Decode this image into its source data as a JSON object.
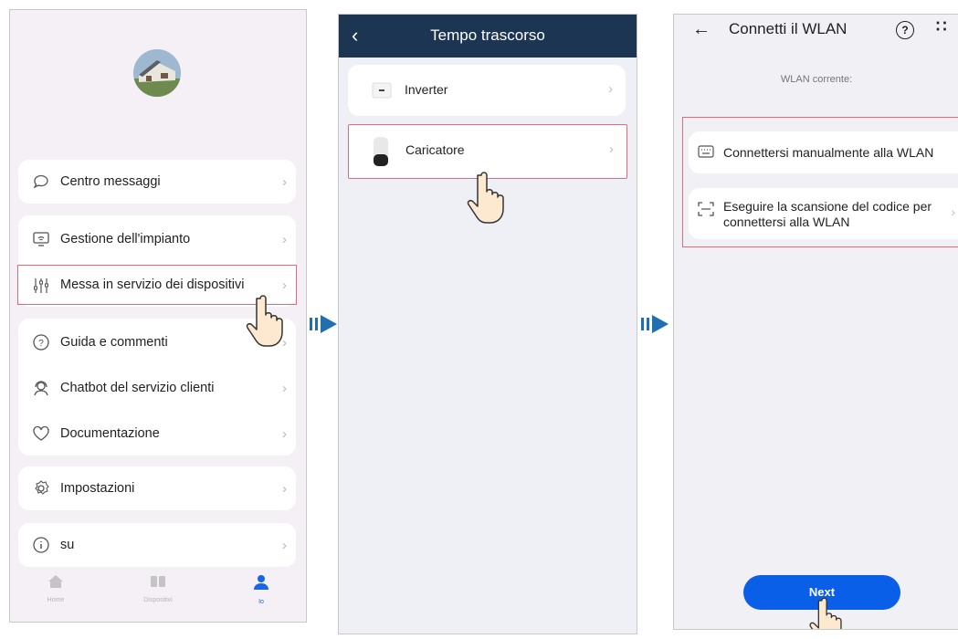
{
  "screen1": {
    "menu": {
      "messages": "Centro messaggi",
      "plant": "Gestione dell'impianto",
      "commissioning": "Messa in servizio dei dispositivi",
      "guide": "Guida e commenti",
      "chatbot": "Chatbot del servizio clienti",
      "docs": "Documentazione",
      "settings": "Impostazioni",
      "about": "su"
    },
    "tabs": {
      "home": "Home",
      "devices": "Dispositivi",
      "me": "Io"
    },
    "colors": {
      "active_tab": "#1767e6",
      "highlight": "#e36a78"
    }
  },
  "screen2": {
    "title": "Tempo trascorso",
    "items": {
      "inverter": "Inverter",
      "charger": "Caricatore"
    },
    "colors": {
      "header": "#1c3553"
    }
  },
  "screen3": {
    "title": "Connetti il WLAN",
    "current_wlan_label": "WLAN corrente:",
    "options": {
      "manual": "Connettersi manualmente alla WLAN",
      "scan_line1": "Eseguire la scansione del codice per",
      "scan_line2": "connettersi alla WLAN"
    },
    "next_label": "Next",
    "colors": {
      "button": "#0a5fe8"
    }
  },
  "arrow_color": "#1f6fb2",
  "chevron": "›"
}
